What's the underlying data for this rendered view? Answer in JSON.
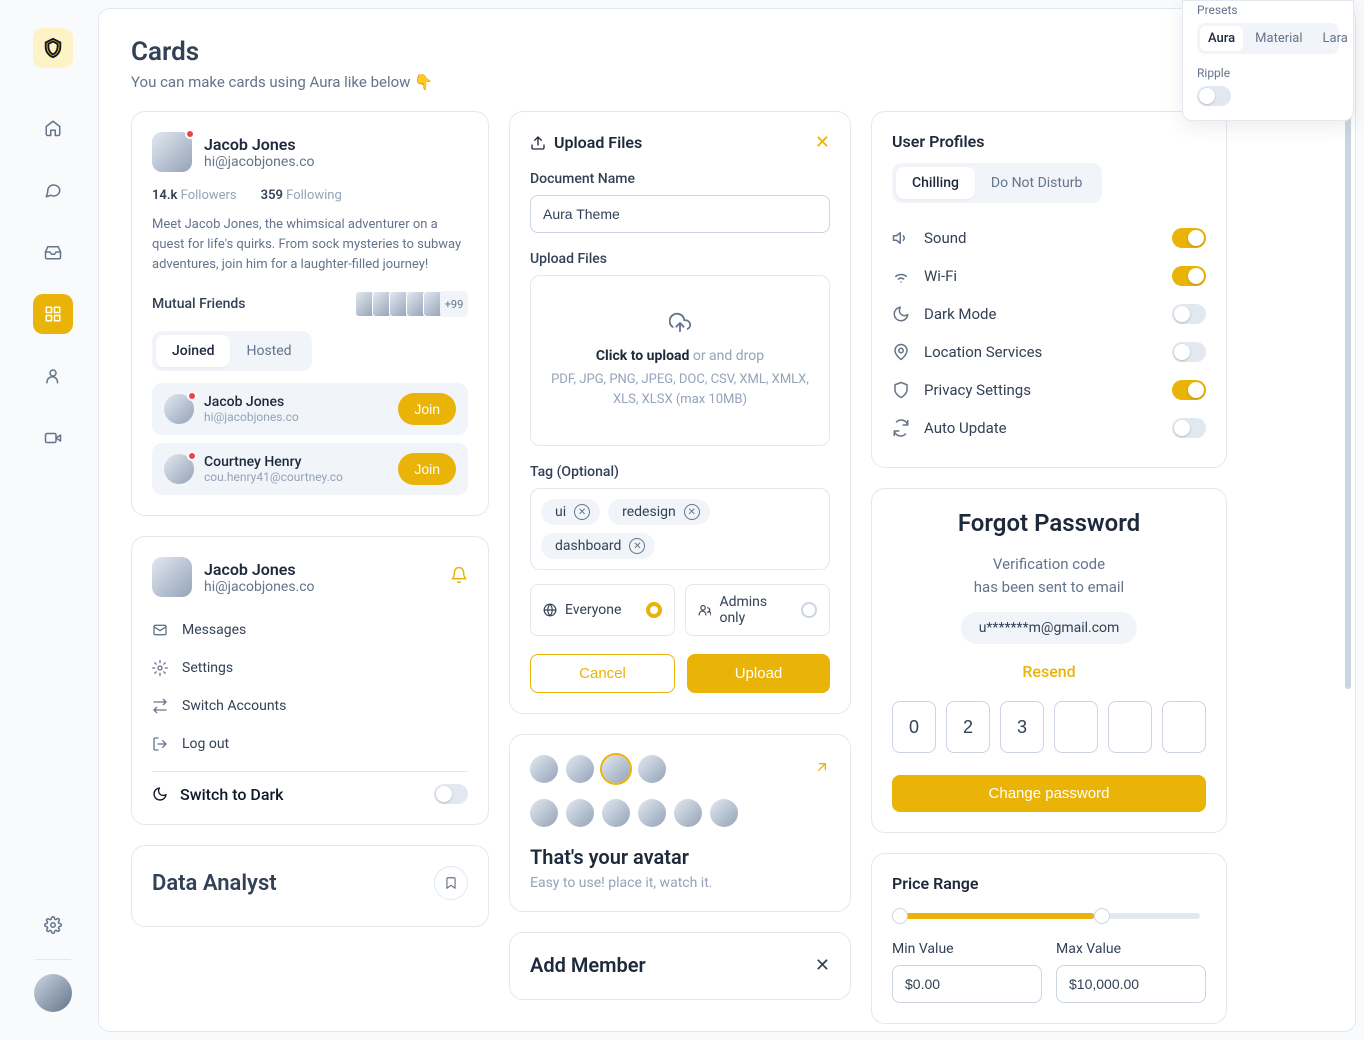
{
  "page": {
    "title": "Cards",
    "subtitle": "You can make cards using Aura like below 👇"
  },
  "settings_panel": {
    "presets_label": "Presets",
    "presets": [
      "Aura",
      "Material",
      "Lara"
    ],
    "active_preset": "Aura",
    "ripple_label": "Ripple"
  },
  "profile_card": {
    "name": "Jacob Jones",
    "email": "hi@jacobjones.co",
    "followers_count": "14.k",
    "followers_label": "Followers",
    "following_count": "359",
    "following_label": "Following",
    "bio": "Meet Jacob Jones, the whimsical adventurer on a quest for life's quirks. From sock mysteries to subway adventures, join him for a laughter-filled journey!",
    "mutual_label": "Mutual Friends",
    "mutual_more": "+99",
    "segments": [
      "Joined",
      "Hosted"
    ],
    "active_segment": "Joined",
    "friends": [
      {
        "name": "Jacob Jones",
        "email": "hi@jacobjones.co",
        "button": "Join"
      },
      {
        "name": "Courtney Henry",
        "email": "cou.henry41@courtney.co",
        "button": "Join"
      }
    ]
  },
  "menu_card": {
    "name": "Jacob Jones",
    "email": "hi@jacobjones.co",
    "items": [
      "Messages",
      "Settings",
      "Switch Accounts",
      "Log out"
    ],
    "dark_label": "Switch to Dark"
  },
  "data_analyst": {
    "title": "Data Analyst"
  },
  "upload": {
    "title": "Upload Files",
    "doc_label": "Document Name",
    "doc_value": "Aura Theme",
    "files_label": "Upload Files",
    "drop_cta": "Click to upload",
    "drop_rest": "or and drop",
    "formats": "PDF, JPG, PNG, JPEG, DOC, CSV, XML, XMLX, XLS, XLSX (max 10MB)",
    "tag_label": "Tag (Optional)",
    "tags": [
      "ui",
      "redesign",
      "dashboard"
    ],
    "visibility": {
      "everyone": "Everyone",
      "admins": "Admins only"
    },
    "cancel": "Cancel",
    "upload_btn": "Upload"
  },
  "avatar_card": {
    "title": "That's your avatar",
    "sub": "Easy to use! place it, watch it."
  },
  "add_member": {
    "title": "Add Member"
  },
  "user_profiles": {
    "title": "User Profiles",
    "segments": [
      "Chilling",
      "Do Not Disturb"
    ],
    "active_segment": "Chilling",
    "settings": [
      {
        "name": "Sound",
        "on": true
      },
      {
        "name": "Wi-Fi",
        "on": true
      },
      {
        "name": "Dark Mode",
        "on": false
      },
      {
        "name": "Location Services",
        "on": false
      },
      {
        "name": "Privacy Settings",
        "on": true
      },
      {
        "name": "Auto Update",
        "on": false
      }
    ]
  },
  "forgot": {
    "title": "Forgot Password",
    "line1": "Verification code",
    "line2": "has been sent to email",
    "email": "u*******m@gmail.com",
    "resend": "Resend",
    "otp": [
      "0",
      "2",
      "3",
      "",
      "",
      ""
    ],
    "button": "Change password"
  },
  "price": {
    "title": "Price Range",
    "min_label": "Min Value",
    "max_label": "Max Value",
    "min_value": "$0.00",
    "max_value": "$10,000.00"
  }
}
